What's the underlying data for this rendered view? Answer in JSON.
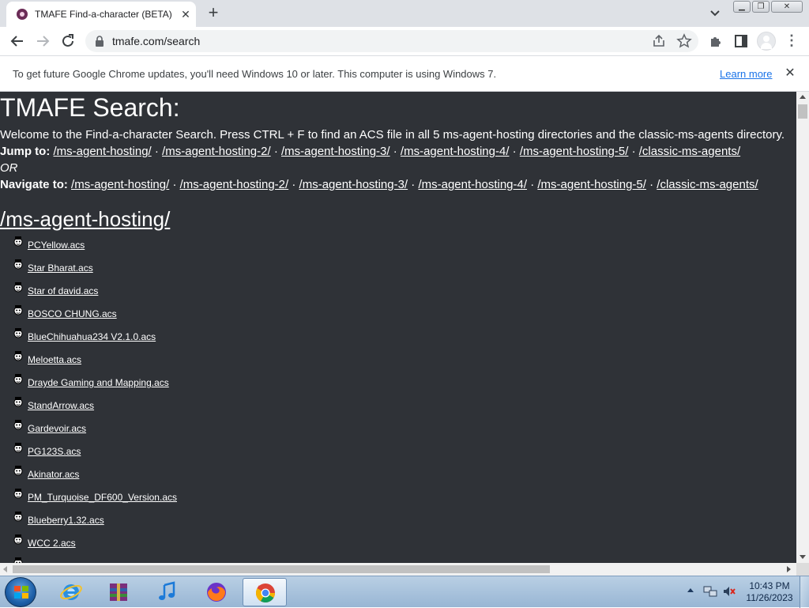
{
  "browser": {
    "tab_title": "TMAFE Find-a-character (BETA)",
    "tab_close": "✕",
    "new_tab": "+",
    "url": "tmafe.com/search"
  },
  "infobar": {
    "message": "To get future Google Chrome updates, you'll need Windows 10 or later. This computer is using Windows 7.",
    "link": "Learn more",
    "close": "✕"
  },
  "page": {
    "title": "TMAFE Search:",
    "intro": "Welcome to the Find-a-character Search. Press CTRL + F to find an ACS file in all 5 ms-agent-hosting directories and the classic-ms-agents directory.",
    "jump_label": "Jump to:",
    "or_label": "OR",
    "navigate_label": "Navigate to:",
    "separator": "·",
    "directories": [
      "/ms-agent-hosting/",
      "/ms-agent-hosting-2/",
      "/ms-agent-hosting-3/",
      "/ms-agent-hosting-4/",
      "/ms-agent-hosting-5/",
      "/classic-ms-agents/"
    ],
    "section_title": "/ms-agent-hosting/",
    "files": [
      "PCYellow.acs",
      "Star Bharat.acs",
      "Star of david.acs",
      "BOSCO CHUNG.acs",
      "BlueChihuahua234 V2.1.0.acs",
      "Meloetta.acs",
      "Drayde Gaming and Mapping.acs",
      "StandArrow.acs",
      "Gardevoir.acs",
      "PG123S.acs",
      "Akinator.acs",
      "PM_Turquoise_DF600_Version.acs",
      "Blueberry1.32.acs",
      "WCC 2.acs"
    ]
  },
  "taskbar": {
    "time": "10:43 PM",
    "date": "11/26/2023"
  },
  "colors": {
    "page_background": "#2f3237",
    "link": "#ffffff",
    "infobar_link": "#1a73e8"
  }
}
